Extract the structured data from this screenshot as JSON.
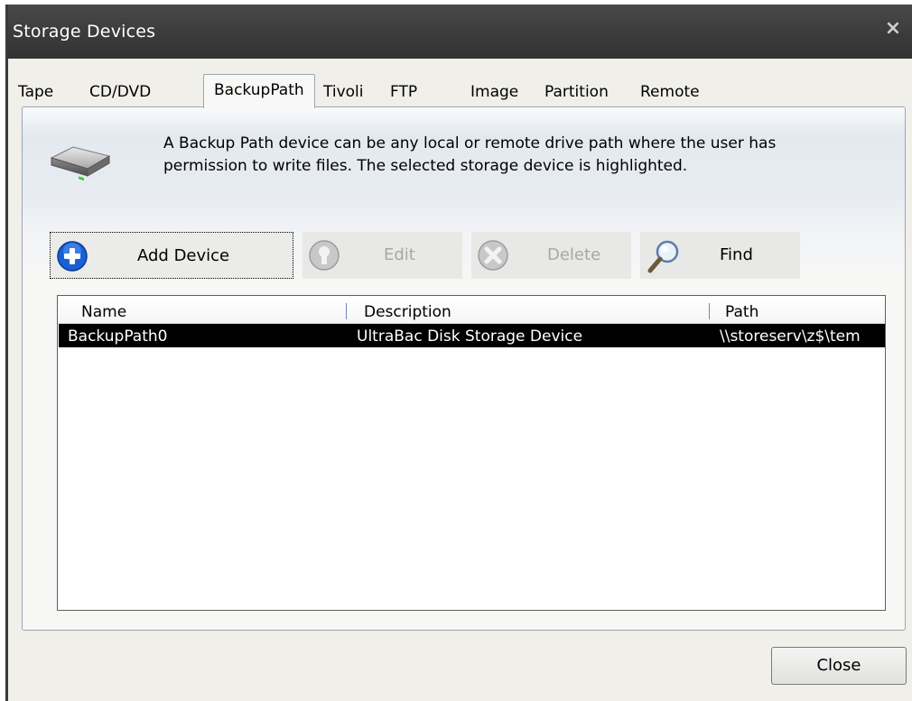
{
  "window": {
    "title": "Storage Devices",
    "close_glyph": "×"
  },
  "tabs": [
    {
      "label": "Tape"
    },
    {
      "label": "CD/DVD"
    },
    {
      "label": "BackupPath",
      "active": true
    },
    {
      "label": "Tivoli"
    },
    {
      "label": "FTP"
    },
    {
      "label": "Image"
    },
    {
      "label": "Partition"
    },
    {
      "label": "Remote"
    }
  ],
  "info": {
    "icon": "hard-drive-icon",
    "line1": "A Backup Path device can be any local or remote drive path where the user has",
    "line2": "permission to write files.  The selected storage device is highlighted."
  },
  "toolbar": {
    "add_label": "Add Device",
    "edit_label": "Edit",
    "delete_label": "Delete",
    "find_label": "Find"
  },
  "list": {
    "columns": [
      "Name",
      "Description",
      "Path"
    ],
    "rows": [
      {
        "name": "BackupPath0",
        "description": "UltraBac Disk Storage Device",
        "path": "\\\\storeserv\\z$\\tem",
        "selected": true
      }
    ]
  },
  "footer": {
    "close_label": "Close"
  },
  "colors": {
    "selection": "#000000",
    "titlebar": "#3b3b3b",
    "add_icon": "#1a5fd6"
  }
}
